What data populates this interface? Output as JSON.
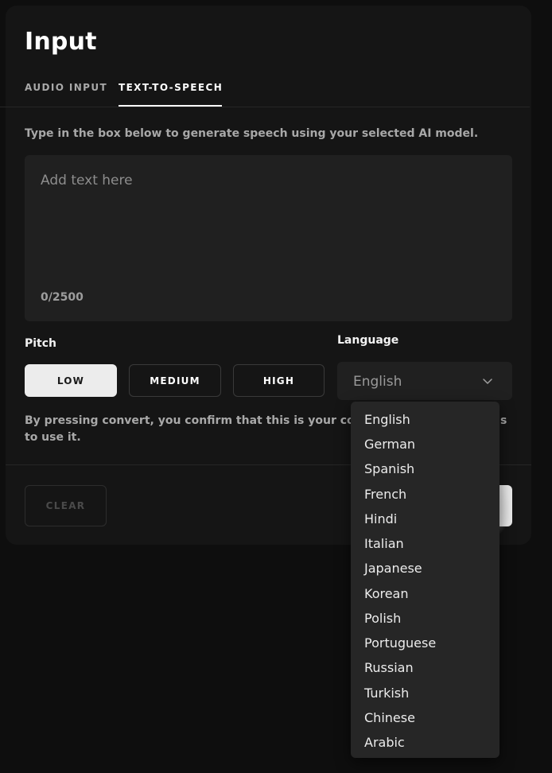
{
  "header": {
    "title": "Input"
  },
  "tabs": [
    {
      "label": "AUDIO INPUT",
      "active": false
    },
    {
      "label": "TEXT-TO-SPEECH",
      "active": true
    }
  ],
  "hint": "Type in the box below to generate speech using your selected AI model.",
  "text_input": {
    "placeholder": "Add text here",
    "counter": "0/2500"
  },
  "pitch": {
    "label": "Pitch",
    "options": [
      "LOW",
      "MEDIUM",
      "HIGH"
    ],
    "selected": "LOW"
  },
  "language": {
    "label": "Language",
    "selected": "English",
    "options": [
      "English",
      "German",
      "Spanish",
      "French",
      "Hindi",
      "Italian",
      "Japanese",
      "Korean",
      "Polish",
      "Portuguese",
      "Russian",
      "Turkish",
      "Chinese",
      "Arabic"
    ]
  },
  "disclaimer": {
    "line1": "By pressing convert, you confirm that this is your conte",
    "line1_tail": "s",
    "line2": "to use it."
  },
  "actions": {
    "clear_label": "CLEAR"
  },
  "colors": {
    "background": "#0e0e0e",
    "panel": "#151515",
    "accent": "#ffffff"
  },
  "icons": {
    "select_chevron": "chevron-down-icon"
  }
}
